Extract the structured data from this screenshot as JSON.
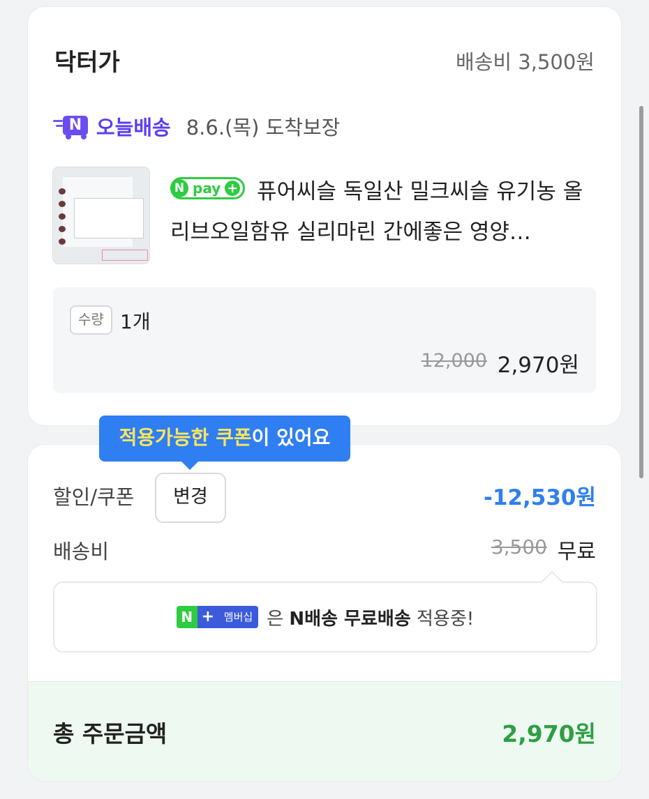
{
  "seller": {
    "name": "닥터가",
    "shipping_fee": "배송비 3,500원"
  },
  "delivery": {
    "icon": "n-delivery-truck-icon",
    "badge": "오늘배송",
    "date": "8.6.(목) 도착보장"
  },
  "product": {
    "npay_label": "pay",
    "title": "퓨어씨슬 독일산 밀크씨슬 유기농 올리브오일함유 실리마린 간에좋은 영양…",
    "quantity_tag": "수량",
    "quantity": "1개",
    "original_price": "12,000",
    "price": "2,970원"
  },
  "tooltip": {
    "highlight": "적용가능한 쿠폰",
    "rest": "이 있어요"
  },
  "summary": {
    "discount_label": "할인/쿠폰",
    "change_button": "변경",
    "discount_value": "-12,530원",
    "shipping_label": "배송비",
    "shipping_original": "3,500",
    "shipping_value": "무료"
  },
  "membership": {
    "badge_n": "N",
    "badge_plus": "+",
    "badge_text": "멤버십",
    "text_pre": "은",
    "text_bold": "N배송 무료배송",
    "text_post": "적용중!"
  },
  "total": {
    "label": "총 주문금액",
    "value": "2,970원"
  },
  "colors": {
    "accent_blue": "#2f7ef2",
    "npay_green": "#2ecc40",
    "total_green": "#2f9e44",
    "delivery_purple": "#5a3df5"
  }
}
